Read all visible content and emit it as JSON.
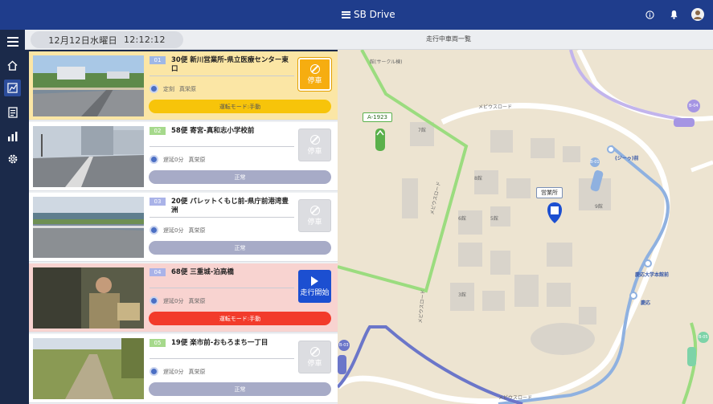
{
  "app": {
    "brand": "SB Drive"
  },
  "header": {
    "date": "12月12日水曜日",
    "time": "12:12:12",
    "page_title": "走行中車両一覧"
  },
  "icons": {
    "menu": "menu-icon",
    "home": "home-icon",
    "map": "map-icon",
    "list": "list-icon",
    "chart": "chart-icon",
    "settings": "gear-icon",
    "info": "info-icon",
    "bell": "bell-icon",
    "user": "user-icon"
  },
  "vehicles": [
    {
      "num": "01",
      "route": "30便 新川営業所-県立医療センター東口",
      "delay": "定刻",
      "driver": "真栄原",
      "status": "運転モード:手動",
      "action": "停車"
    },
    {
      "num": "02",
      "route": "58便 寄宮-真和志小学校前",
      "delay": "遅延0分",
      "driver": "真栄原",
      "status": "正常",
      "action": "停車"
    },
    {
      "num": "03",
      "route": "20便 パレットくもじ前-県庁前港湾豊洲",
      "delay": "遅延0分",
      "driver": "真栄原",
      "status": "正常",
      "action": "停車"
    },
    {
      "num": "04",
      "route": "68便 三重城-泊高橋",
      "delay": "遅延0分",
      "driver": "真栄原",
      "status": "運転モード:手動",
      "action": "走行開始"
    },
    {
      "num": "05",
      "route": "19便 楽市前-おもろまち一丁目",
      "delay": "遅延0分",
      "driver": "真栄原",
      "status": "正常",
      "action": "停車"
    }
  ],
  "map": {
    "office_label": "営業所",
    "vehicle_label": "A-1923",
    "road_top": "メビウスロード",
    "road_left": "メビウスロード",
    "road_left_lower": "メビウスロード",
    "road_bottom": "メビウスロード",
    "place_1": "(ジーゥ)前",
    "place_2": "慶応大学本館前",
    "place_3": "慶応",
    "marker_b04": "B-04",
    "marker_b01": "B-01",
    "marker_b03": "B-03",
    "marker_b05": "B-05",
    "building_label": "7館",
    "building_1": "8館",
    "building_2": "6館",
    "building_3": "9館",
    "building_4": "3館",
    "building_5": "5館",
    "place_top": "館(サークル棟)"
  }
}
